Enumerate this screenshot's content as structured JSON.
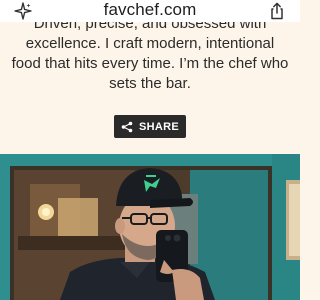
{
  "browser": {
    "address": "favchef.com",
    "left_icon": "sparkle-icon",
    "right_icon": "share-icon"
  },
  "bio": {
    "line_1": "Driven, precise, and obsessed with",
    "line_2": "excellence. I craft modern, intentional",
    "line_3": "food that hits every time. I’m the chef who",
    "line_4": "sets the bar."
  },
  "share_button": {
    "label": "SHARE",
    "icon": "share-nodes-icon"
  },
  "photo": {
    "description_icon": "profile-photo",
    "cap_color": "#1a1d22",
    "logo_color": "#3fcf8e",
    "wall_color": "#2f8f8f"
  }
}
